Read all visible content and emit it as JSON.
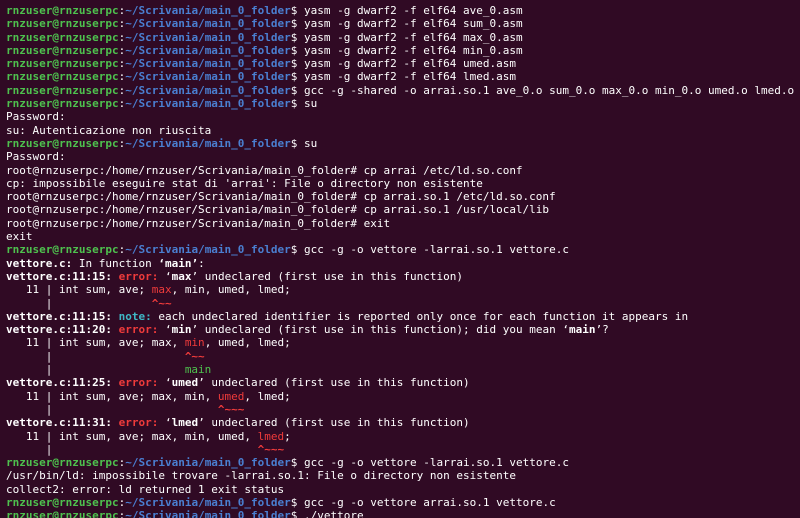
{
  "terminal": {
    "lines": [
      [
        [
          "user",
          "rnzuser@rnzuserpc"
        ],
        [
          "plain",
          ":"
        ],
        [
          "path",
          "~/Scrivania/main_0_folder"
        ],
        [
          "plain",
          "$ yasm -g dwarf2 -f elf64 ave_0.asm"
        ]
      ],
      [
        [
          "user",
          "rnzuser@rnzuserpc"
        ],
        [
          "plain",
          ":"
        ],
        [
          "path",
          "~/Scrivania/main_0_folder"
        ],
        [
          "plain",
          "$ yasm -g dwarf2 -f elf64 sum_0.asm"
        ]
      ],
      [
        [
          "user",
          "rnzuser@rnzuserpc"
        ],
        [
          "plain",
          ":"
        ],
        [
          "path",
          "~/Scrivania/main_0_folder"
        ],
        [
          "plain",
          "$ yasm -g dwarf2 -f elf64 max_0.asm"
        ]
      ],
      [
        [
          "user",
          "rnzuser@rnzuserpc"
        ],
        [
          "plain",
          ":"
        ],
        [
          "path",
          "~/Scrivania/main_0_folder"
        ],
        [
          "plain",
          "$ yasm -g dwarf2 -f elf64 min_0.asm"
        ]
      ],
      [
        [
          "user",
          "rnzuser@rnzuserpc"
        ],
        [
          "plain",
          ":"
        ],
        [
          "path",
          "~/Scrivania/main_0_folder"
        ],
        [
          "plain",
          "$ yasm -g dwarf2 -f elf64 umed.asm"
        ]
      ],
      [
        [
          "user",
          "rnzuser@rnzuserpc"
        ],
        [
          "plain",
          ":"
        ],
        [
          "path",
          "~/Scrivania/main_0_folder"
        ],
        [
          "plain",
          "$ yasm -g dwarf2 -f elf64 lmed.asm"
        ]
      ],
      [
        [
          "user",
          "rnzuser@rnzuserpc"
        ],
        [
          "plain",
          ":"
        ],
        [
          "path",
          "~/Scrivania/main_0_folder"
        ],
        [
          "plain",
          "$ gcc -g -shared -o arrai.so.1 ave_0.o sum_0.o max_0.o min_0.o umed.o lmed.o"
        ]
      ],
      [
        [
          "user",
          "rnzuser@rnzuserpc"
        ],
        [
          "plain",
          ":"
        ],
        [
          "path",
          "~/Scrivania/main_0_folder"
        ],
        [
          "plain",
          "$ su"
        ]
      ],
      [
        [
          "plain",
          "Password:"
        ]
      ],
      [
        [
          "plain",
          "su: Autenticazione non riuscita"
        ]
      ],
      [
        [
          "user",
          "rnzuser@rnzuserpc"
        ],
        [
          "plain",
          ":"
        ],
        [
          "path",
          "~/Scrivania/main_0_folder"
        ],
        [
          "plain",
          "$ su"
        ]
      ],
      [
        [
          "plain",
          "Password:"
        ]
      ],
      [
        [
          "plain",
          "root@rnzuserpc:/home/rnzuser/Scrivania/main_0_folder# cp arrai /etc/ld.so.conf"
        ]
      ],
      [
        [
          "plain",
          "cp: impossibile eseguire stat di 'arrai': File o directory non esistente"
        ]
      ],
      [
        [
          "plain",
          "root@rnzuserpc:/home/rnzuser/Scrivania/main_0_folder# cp arrai.so.1 /etc/ld.so.conf"
        ]
      ],
      [
        [
          "plain",
          "root@rnzuserpc:/home/rnzuser/Scrivania/main_0_folder# cp arrai.so.1 /usr/local/lib"
        ]
      ],
      [
        [
          "plain",
          "root@rnzuserpc:/home/rnzuser/Scrivania/main_0_folder# exit"
        ]
      ],
      [
        [
          "plain",
          "exit"
        ]
      ],
      [
        [
          "user",
          "rnzuser@rnzuserpc"
        ],
        [
          "plain",
          ":"
        ],
        [
          "path",
          "~/Scrivania/main_0_folder"
        ],
        [
          "plain",
          "$ gcc -g -o vettore -larrai.so.1 vettore.c"
        ]
      ],
      [
        [
          "bold",
          "vettore.c:"
        ],
        [
          "plain",
          " In function "
        ],
        [
          "bold",
          "‘main’"
        ],
        [
          "plain",
          ":"
        ]
      ],
      [
        [
          "bold",
          "vettore.c:11:15: "
        ],
        [
          "err",
          "error: "
        ],
        [
          "plain",
          "‘"
        ],
        [
          "bold",
          "max"
        ],
        [
          "plain",
          "’ undeclared (first use in this function)"
        ]
      ],
      [
        [
          "plain",
          "   11 | int sum, ave; "
        ],
        [
          "red",
          "max"
        ],
        [
          "plain",
          ", min, umed, lmed;"
        ]
      ],
      [
        [
          "plain",
          "      |               "
        ],
        [
          "redb",
          "^~~"
        ]
      ],
      [
        [
          "bold",
          "vettore.c:11:15: "
        ],
        [
          "note",
          "note: "
        ],
        [
          "plain",
          "each undeclared identifier is reported only once for each function it appears in"
        ]
      ],
      [
        [
          "bold",
          "vettore.c:11:20: "
        ],
        [
          "err",
          "error: "
        ],
        [
          "plain",
          "‘"
        ],
        [
          "bold",
          "min"
        ],
        [
          "plain",
          "’ undeclared (first use in this function); did you mean ‘"
        ],
        [
          "bold",
          "main"
        ],
        [
          "plain",
          "’?"
        ]
      ],
      [
        [
          "plain",
          "   11 | int sum, ave; max, "
        ],
        [
          "red",
          "min"
        ],
        [
          "plain",
          ", umed, lmed;"
        ]
      ],
      [
        [
          "plain",
          "      |                    "
        ],
        [
          "redb",
          "^~~"
        ]
      ],
      [
        [
          "plain",
          "      |                    "
        ],
        [
          "green",
          "main"
        ]
      ],
      [
        [
          "bold",
          "vettore.c:11:25: "
        ],
        [
          "err",
          "error: "
        ],
        [
          "plain",
          "‘"
        ],
        [
          "bold",
          "umed"
        ],
        [
          "plain",
          "’ undeclared (first use in this function)"
        ]
      ],
      [
        [
          "plain",
          "   11 | int sum, ave; max, min, "
        ],
        [
          "red",
          "umed"
        ],
        [
          "plain",
          ", lmed;"
        ]
      ],
      [
        [
          "plain",
          "      |                         "
        ],
        [
          "redb",
          "^~~~"
        ]
      ],
      [
        [
          "bold",
          "vettore.c:11:31: "
        ],
        [
          "err",
          "error: "
        ],
        [
          "plain",
          "‘"
        ],
        [
          "bold",
          "lmed"
        ],
        [
          "plain",
          "’ undeclared (first use in this function)"
        ]
      ],
      [
        [
          "plain",
          "   11 | int sum, ave; max, min, umed, "
        ],
        [
          "red",
          "lmed"
        ],
        [
          "plain",
          ";"
        ]
      ],
      [
        [
          "plain",
          "      |                               "
        ],
        [
          "redb",
          "^~~~"
        ]
      ],
      [
        [
          "user",
          "rnzuser@rnzuserpc"
        ],
        [
          "plain",
          ":"
        ],
        [
          "path",
          "~/Scrivania/main_0_folder"
        ],
        [
          "plain",
          "$ gcc -g -o vettore -larrai.so.1 vettore.c"
        ]
      ],
      [
        [
          "plain",
          "/usr/bin/ld: impossibile trovare -larrai.so.1: File o directory non esistente"
        ]
      ],
      [
        [
          "plain",
          "collect2: error: ld returned 1 exit status"
        ]
      ],
      [
        [
          "user",
          "rnzuser@rnzuserpc"
        ],
        [
          "plain",
          ":"
        ],
        [
          "path",
          "~/Scrivania/main_0_folder"
        ],
        [
          "plain",
          "$ gcc -g -o vettore arrai.so.1 vettore.c"
        ]
      ],
      [
        [
          "user",
          "rnzuser@rnzuserpc"
        ],
        [
          "plain",
          ":"
        ],
        [
          "path",
          "~/Scrivania/main_0_folder"
        ],
        [
          "plain",
          "$ ./vettore"
        ]
      ]
    ]
  },
  "colors": {
    "background": "#300a24",
    "prompt_user": "#4ec14e",
    "prompt_path": "#4a7fd1",
    "error": "#ef3b3b",
    "note": "#3fb8c6",
    "text": "#ffffff"
  }
}
